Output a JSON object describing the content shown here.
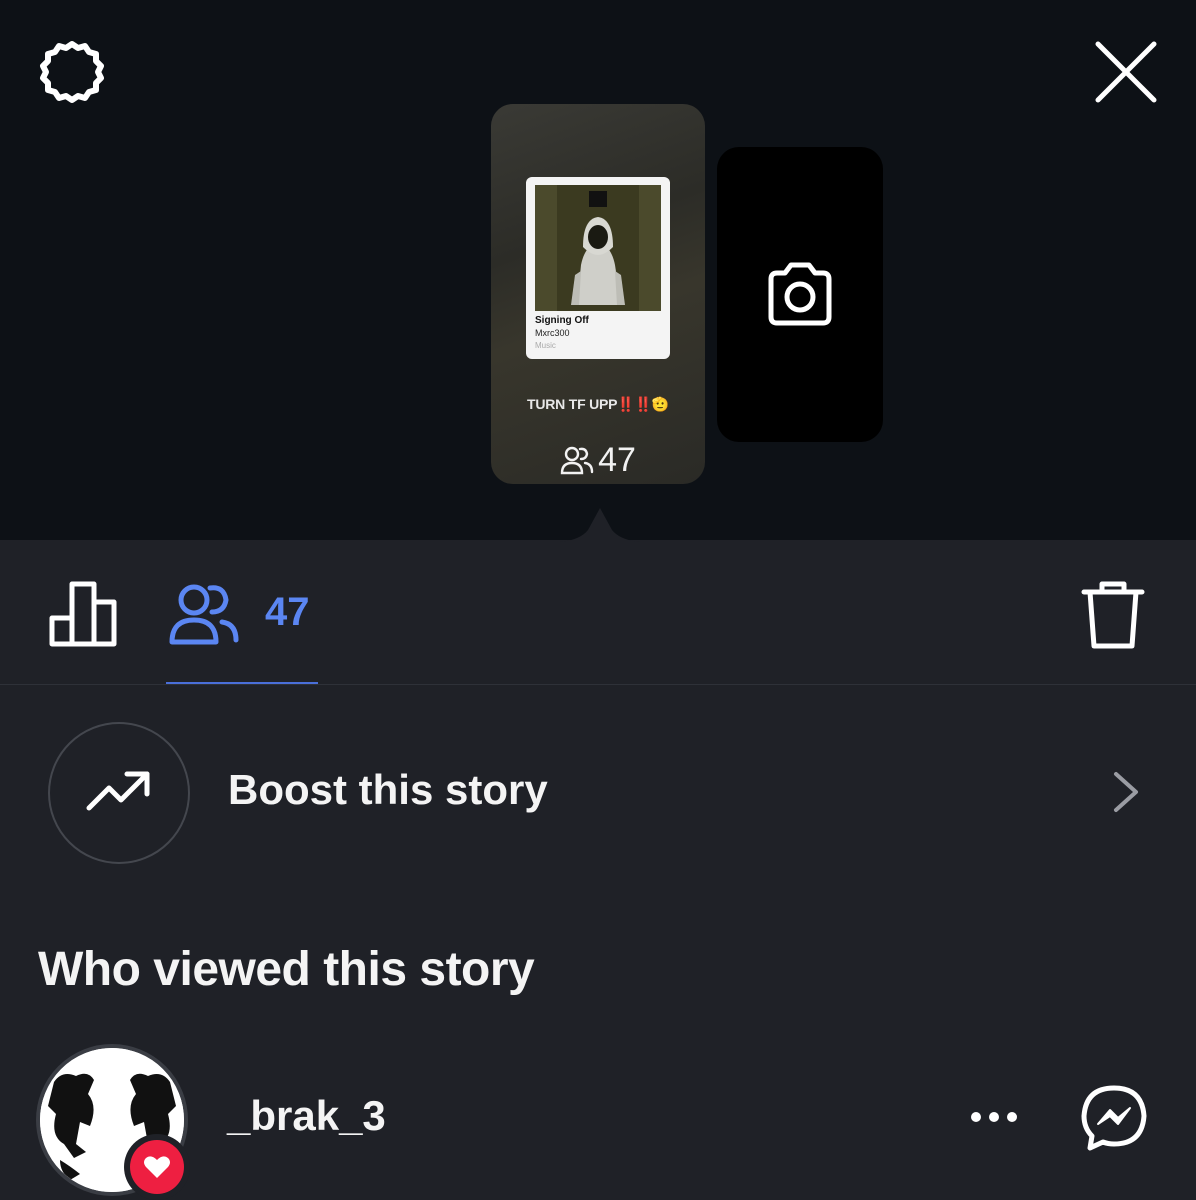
{
  "header": {
    "settings_icon": "gear-icon",
    "close_icon": "close-icon"
  },
  "story": {
    "music": {
      "title": "Signing Off",
      "artist": "Mxrc300",
      "service": "Music"
    },
    "caption_text": "TURN TF UPP",
    "caption_marks": "‼️‼️",
    "caption_tail": "🫡",
    "views": "47"
  },
  "add_story": {
    "icon": "camera-icon"
  },
  "tabs": {
    "insights_icon": "bar-chart-icon",
    "viewers_icon": "people-icon",
    "viewers_count": "47",
    "delete_icon": "trash-icon",
    "accent_color": "#5b86f2"
  },
  "boost": {
    "label": "Boost this story"
  },
  "viewers_section": {
    "title": "Who viewed this story",
    "viewers": [
      {
        "username": "_brak_3",
        "reaction": "heart-icon"
      }
    ]
  }
}
